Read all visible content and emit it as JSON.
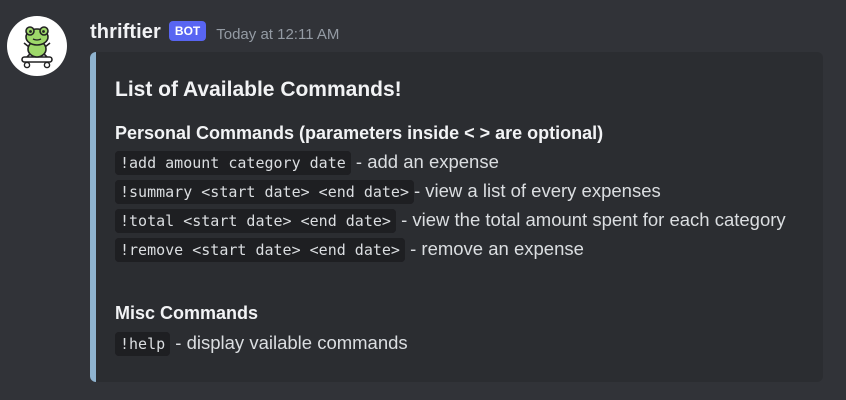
{
  "message": {
    "username": "thriftier",
    "bot_tag": "BOT",
    "timestamp": "Today at 12:11 AM",
    "avatar_icon": "frog-on-skateboard-icon"
  },
  "embed": {
    "accent_color": "#8fb3cf",
    "title": "List of Available Commands!",
    "personal": {
      "name": "Personal Commands (parameters inside < > are optional)",
      "commands": [
        {
          "code": "!add amount category date",
          "desc": " - add an expense"
        },
        {
          "code": "!summary <start date> <end date>",
          "desc": "- view a list of every expenses"
        },
        {
          "code": "!total <start date> <end date>",
          "desc": " - view the total amount spent for each category"
        },
        {
          "code": "!remove <start date> <end date>",
          "desc": " - remove an expense"
        }
      ]
    },
    "misc": {
      "name": "Misc Commands",
      "commands": [
        {
          "code": "!help",
          "desc": " - display vailable commands"
        }
      ]
    }
  }
}
